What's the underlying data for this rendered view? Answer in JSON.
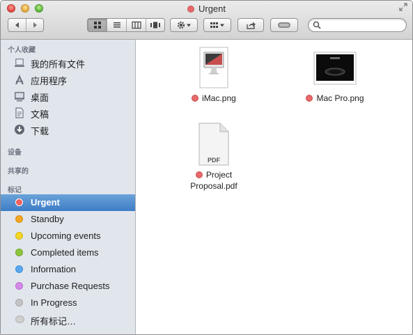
{
  "window": {
    "title": "Urgent",
    "title_tag_color": "#e8696a"
  },
  "toolbar": {
    "back_icon": "chevron-left-icon",
    "forward_icon": "chevron-right-icon",
    "view_modes": [
      "icon-view",
      "list-view",
      "column-view",
      "cover-flow-view"
    ],
    "active_view": "icon-view",
    "action_icon": "gear-icon",
    "arrange_icon": "arrange-icon",
    "share_icon": "share-icon",
    "tags_icon": "tag-toggle-icon",
    "search": {
      "placeholder": "",
      "value": ""
    }
  },
  "sidebar": {
    "favorites_header": "个人收藏",
    "favorites": [
      {
        "label": "我的所有文件",
        "icon": "all-files-icon"
      },
      {
        "label": "应用程序",
        "icon": "applications-icon"
      },
      {
        "label": "桌面",
        "icon": "desktop-icon"
      },
      {
        "label": "文稿",
        "icon": "documents-icon"
      },
      {
        "label": "下载",
        "icon": "downloads-icon"
      }
    ],
    "devices_header": "设备",
    "shared_header": "共享的",
    "tags_header": "标记",
    "tags": [
      {
        "label": "Urgent",
        "color": "#f25f5c",
        "selected": true
      },
      {
        "label": "Standby",
        "color": "#f5a623",
        "selected": false
      },
      {
        "label": "Upcoming events",
        "color": "#f4d623",
        "selected": false
      },
      {
        "label": "Completed items",
        "color": "#8cc63f",
        "selected": false
      },
      {
        "label": "Information",
        "color": "#5aa9f0",
        "selected": false
      },
      {
        "label": "Purchase Requests",
        "color": "#d58ae9",
        "selected": false
      },
      {
        "label": "In Progress",
        "color": "#c4c4c4",
        "selected": false
      },
      {
        "label": "所有标记…",
        "color": "#c8c8c8",
        "selected": false
      }
    ]
  },
  "files": [
    {
      "name": "iMac.png",
      "tag_color": "#e8696a",
      "icon": "imac-image-icon"
    },
    {
      "name": "Mac Pro.png",
      "tag_color": "#e8696a",
      "icon": "mac-pro-image-icon"
    },
    {
      "name_line1": "Project",
      "name_line2": "Proposal.pdf",
      "tag_color": "#e8696a",
      "icon": "pdf-document-icon",
      "badge": "PDF"
    }
  ]
}
